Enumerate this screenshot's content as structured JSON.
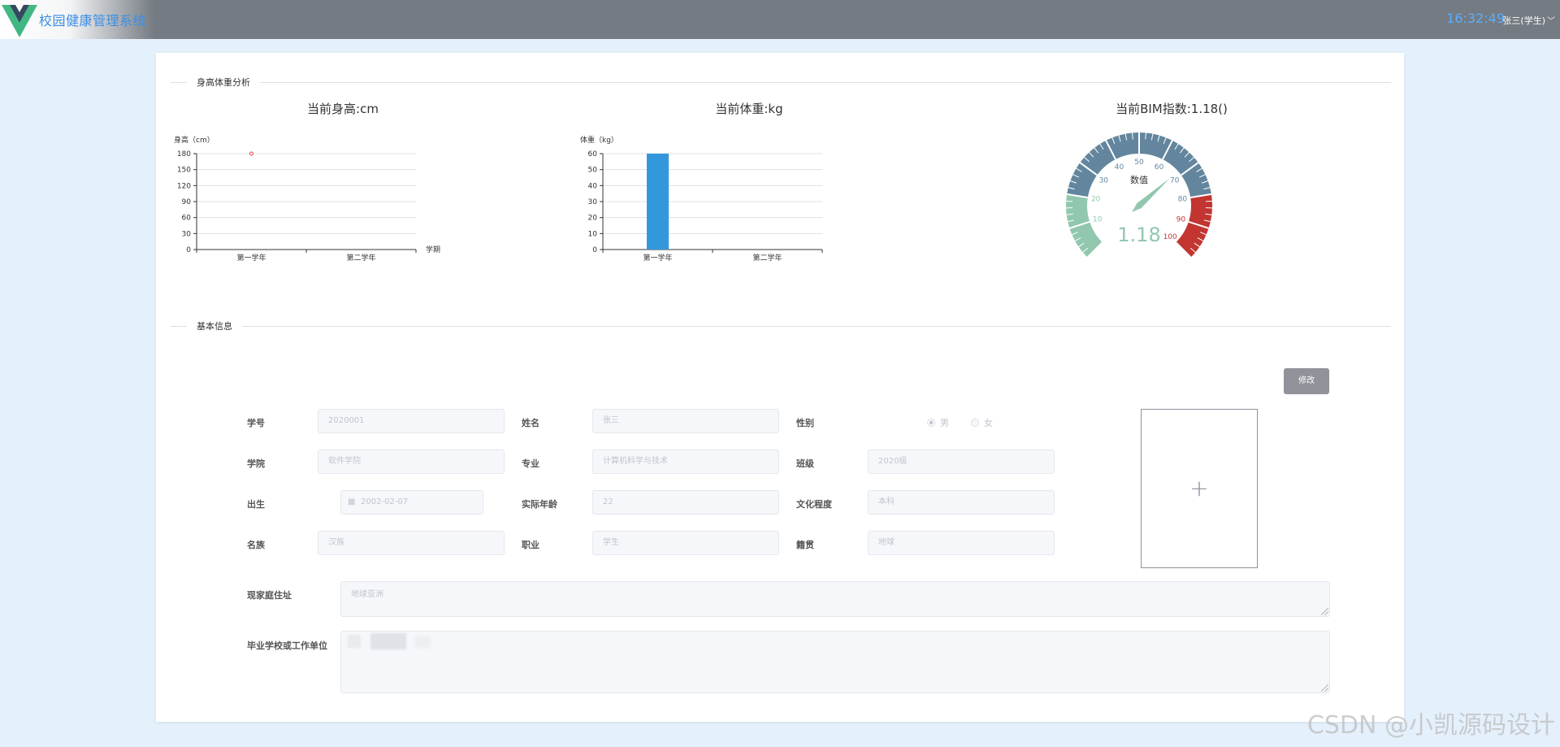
{
  "header": {
    "app_title": "校园健康管理系统",
    "clock": "16:32:49",
    "user": "张三(学生)",
    "user_caret": "﹀"
  },
  "sections": {
    "analysis": "身高体重分析",
    "basic_info": "基本信息"
  },
  "chart_data": [
    {
      "type": "scatter",
      "title": "当前身高:cm",
      "ylabel": "身高（cm）",
      "xlabel": "学期",
      "categories": [
        "第一学年",
        "第二学年"
      ],
      "series": [
        {
          "values": [
            180,
            null
          ]
        }
      ],
      "ylim": [
        0,
        180
      ],
      "yticks": [
        0,
        30,
        60,
        90,
        120,
        150,
        180
      ],
      "grid": true,
      "color": "#e0453a"
    },
    {
      "type": "bar",
      "title": "当前体重:kg",
      "ylabel": "体重（kg）",
      "categories": [
        "第一学年",
        "第二学年"
      ],
      "series": [
        {
          "values": [
            60,
            null
          ]
        }
      ],
      "ylim": [
        0,
        60
      ],
      "yticks": [
        0,
        10,
        20,
        30,
        40,
        50,
        60
      ],
      "grid": true,
      "color": "#3398db"
    },
    {
      "type": "gauge",
      "title": "当前BIM指数:1.18()",
      "label": "数值",
      "value": 1.18,
      "value_text": "1.18",
      "range": [
        0,
        100
      ],
      "ticks": [
        "10",
        "20",
        "30",
        "40",
        "50",
        "60",
        "70",
        "80",
        "90",
        "100"
      ],
      "bands": [
        {
          "to": 20,
          "color": "#91c7ae"
        },
        {
          "to": 80,
          "color": "#63869e"
        },
        {
          "to": 100,
          "color": "#c23531"
        }
      ]
    }
  ],
  "form": {
    "edit_button": "修改",
    "student_id": {
      "label": "学号",
      "value": "2020001"
    },
    "name": {
      "label": "姓名",
      "value": "张三"
    },
    "gender": {
      "label": "性别",
      "options": [
        "男",
        "女"
      ],
      "selected": "男"
    },
    "college": {
      "label": "学院",
      "value": "软件学院"
    },
    "major": {
      "label": "专业",
      "value": "计算机科学与技术"
    },
    "class": {
      "label": "班级",
      "value": "2020级"
    },
    "birth": {
      "label": "出生",
      "value": "2002-02-07"
    },
    "age": {
      "label": "实际年龄",
      "value": "22"
    },
    "education": {
      "label": "文化程度",
      "value": "本科"
    },
    "ethnicity": {
      "label": "名族",
      "value": "汉族"
    },
    "occupation": {
      "label": "职业",
      "value": "学生"
    },
    "native_place": {
      "label": "籍贯",
      "value": "地球"
    },
    "address": {
      "label": "现家庭住址",
      "value": "地球亚洲"
    },
    "school_work": {
      "label": "毕业学校或工作单位",
      "value": ""
    },
    "photo_plus": "+"
  },
  "watermark": "CSDN @小凯源码设计",
  "colors": {
    "topbar": "#757b82",
    "clock": "#5aaeff",
    "page_bg": "#e4f0fb",
    "button": "#909399"
  }
}
